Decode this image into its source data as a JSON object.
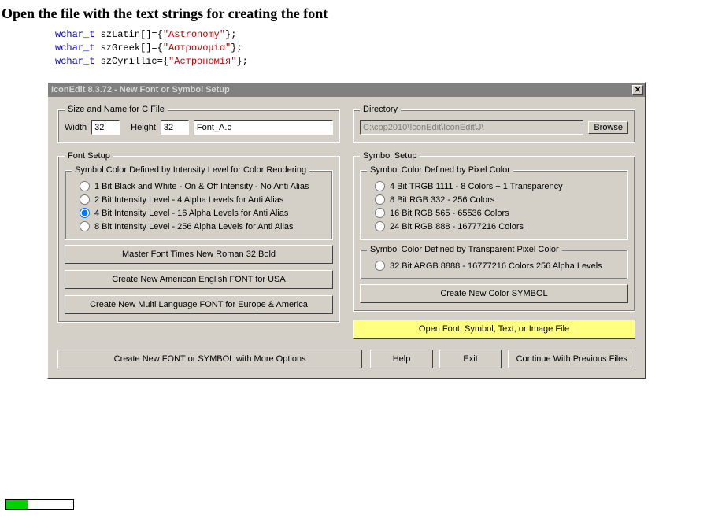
{
  "heading": "Open the file with the text strings for creating the font",
  "code": {
    "kw": "wchar_t",
    "line1_var": " szLatin[]={",
    "line1_str": "\"Astronomy\"",
    "line1_end": "};",
    "line2_var": " szGreek[]={",
    "line2_str": "\"Αστρονομία\"",
    "line2_end": "};",
    "line3_var": " szCyrillic={",
    "line3_str": "\"Астрономія\"",
    "line3_end": "};"
  },
  "dialog": {
    "title": "IconEdit 8.3.72 - New Font or Symbol Setup",
    "close_x": "✕"
  },
  "size_group": {
    "legend": "Size and Name for C File",
    "width_label": "Width",
    "width_value": "32",
    "height_label": "Height",
    "height_value": "32",
    "filename": "Font_A.c"
  },
  "directory": {
    "legend": "Directory",
    "path": "C:\\cpp2010\\IconEdit\\IconEdit\\J\\",
    "browse": "Browse"
  },
  "font_setup": {
    "legend": "Font Setup",
    "intensity_legend": "Symbol Color Defined by Intensity Level for Color Rendering",
    "opt1": "1 Bit Black and White - On & Off Intensity - No Anti Alias",
    "opt2": "2 Bit Intensity Level - 4 Alpha Levels for Anti Alias",
    "opt3": "4 Bit Intensity Level - 16 Alpha Levels for Anti Alias",
    "opt4": "8 Bit Intensity Level - 256 Alpha Levels for Anti Alias",
    "master_font": "Master Font  Times New Roman 32 Bold",
    "create_usa": "Create New American English FONT for USA",
    "create_multi": "Create New Multi Language FONT for Europe & America"
  },
  "symbol_setup": {
    "legend": "Symbol Setup",
    "pixel_legend": "Symbol Color Defined by Pixel Color",
    "opt1": "4 Bit TRGB 1111 - 8 Colors + 1 Transparency",
    "opt2": "8 Bit RGB 332 - 256 Colors",
    "opt3": "16 Bit RGB 565 - 65536 Colors",
    "opt4": "24 Bit RGB 888 - 16777216 Colors",
    "trans_legend": "Symbol Color Defined by Transparent Pixel Color",
    "opt5": "32 Bit ARGB 8888 - 16777216 Colors 256 Alpha Levels",
    "create_color": "Create New Color SYMBOL",
    "open_file": "Open Font, Symbol, Text, or Image File"
  },
  "bottom": {
    "create_more": "Create New FONT or SYMBOL with More Options",
    "help": "Help",
    "exit": "Exit",
    "continue": "Continue With Previous Files"
  },
  "progress": {
    "percent": 33
  }
}
